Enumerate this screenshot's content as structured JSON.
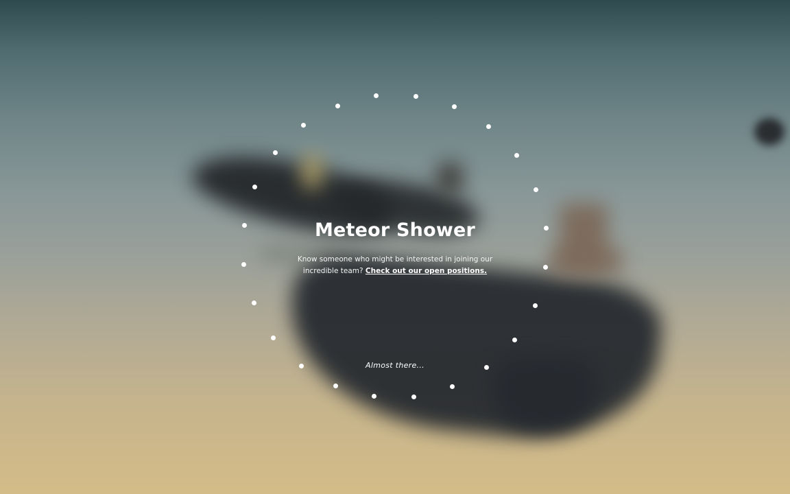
{
  "game": {
    "title": "Meteor Shower",
    "blurb_text": "Know someone who might be interested in joining our incredible team?",
    "blurb_link": "Check out our open positions.",
    "loading_text": "Almost there..."
  },
  "loader": {
    "dot_count": 24,
    "dot_color": "#ffffff"
  },
  "colors": {
    "sky_top": "#2f4a4f",
    "sky_bottom": "#d4bc88",
    "text": "#ffffff"
  }
}
